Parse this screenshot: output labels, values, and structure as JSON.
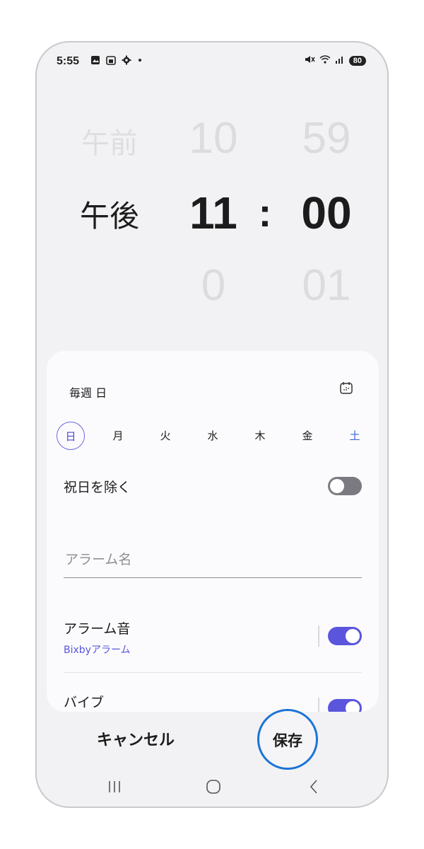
{
  "status_bar": {
    "time": "5:55",
    "battery": "80",
    "left_icons": [
      "gallery-icon",
      "calendar-icon",
      "gear-icon",
      "dot-icon"
    ],
    "right_icons": [
      "mute-icon",
      "wifi-icon",
      "signal-icon"
    ]
  },
  "time_picker": {
    "ampm_prev": "午前",
    "ampm_selected": "午後",
    "hour_prev": "10",
    "hour_selected": "11",
    "hour_next": "0",
    "separator": ":",
    "minute_prev": "59",
    "minute_selected": "00",
    "minute_next": "01"
  },
  "repeat": {
    "label": "毎週 日",
    "days": [
      "日",
      "月",
      "火",
      "水",
      "木",
      "金",
      "土"
    ],
    "selected_day": "日"
  },
  "holidays": {
    "label": "祝日を除く",
    "enabled": false
  },
  "alarm_name": {
    "placeholder": "アラーム名"
  },
  "alarm_sound": {
    "label": "アラーム音",
    "value": "Bixbyアラーム",
    "enabled": true
  },
  "vibration": {
    "label": "バイブ",
    "enabled": true
  },
  "actions": {
    "cancel": "キャンセル",
    "save": "保存"
  },
  "colors": {
    "accent": "#5a55dc",
    "save_ring": "#1b74d6",
    "saturday": "#3b67d6"
  }
}
